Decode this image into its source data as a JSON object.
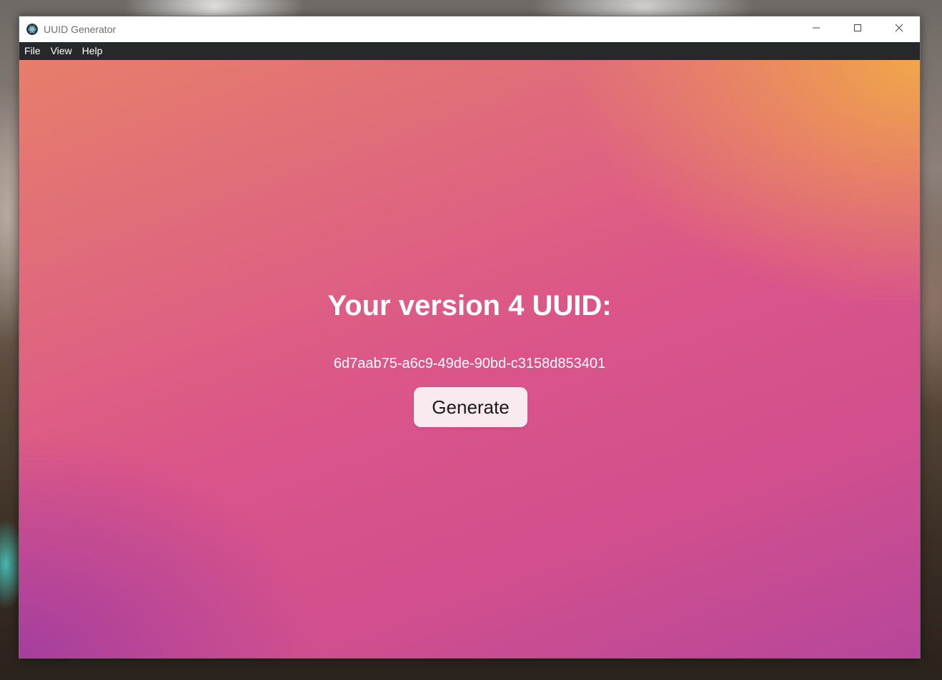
{
  "window": {
    "title": "UUID Generator",
    "controls": {
      "minimize_icon": "minimize-icon",
      "maximize_icon": "maximize-icon",
      "close_icon": "close-icon"
    }
  },
  "menu": {
    "items": [
      {
        "label": "File"
      },
      {
        "label": "View"
      },
      {
        "label": "Help"
      }
    ]
  },
  "main": {
    "heading": "Your version 4 UUID:",
    "uuid": "6d7aab75-a6c9-49de-90bd-c3158d853401",
    "generate_label": "Generate"
  },
  "colors": {
    "menubar": "#27282c",
    "gradient_top_right": "#f2aa46",
    "gradient_mid": "#db5589",
    "gradient_bottom_left": "#a03ca0",
    "button_bg": "#f9eaf0"
  }
}
